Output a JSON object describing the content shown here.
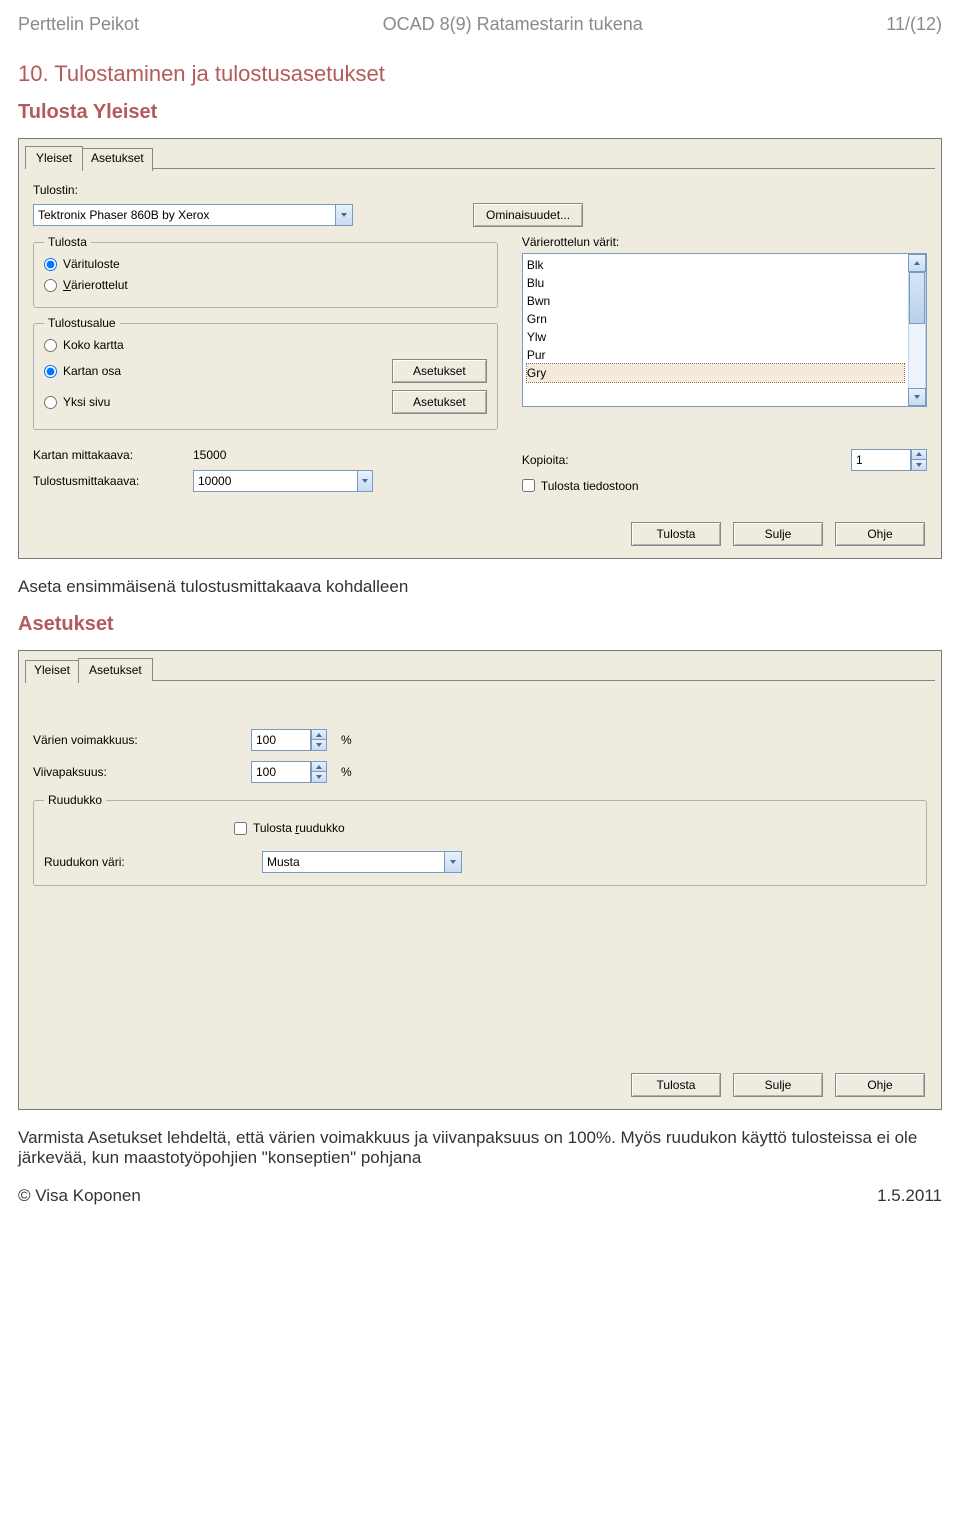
{
  "header": {
    "left": "Perttelin Peikot",
    "center": "OCAD 8(9) Ratamestarin tukena",
    "right": "11/(12)"
  },
  "section_heading": "10. Tulostaminen ja tulostusasetukset",
  "subheading_1": "Tulosta Yleiset",
  "body_text_1": "Aseta ensimmäisenä tulostusmittakaava kohdalleen",
  "subheading_2": "Asetukset",
  "body_text_2": "Varmista Asetukset lehdeltä, että värien voimakkuus ja viivanpaksuus on 100%. Myös ruudukon käyttö tulosteissa ei ole järkevää, kun maastotyöpohjien \"konseptien\" pohjana",
  "footer": {
    "left": "© Visa Koponen",
    "right": "1.5.2011"
  },
  "dialog1": {
    "tabs": {
      "yleiset": "Yleiset",
      "asetukset": "Asetukset"
    },
    "printer_label": "Tulostin:",
    "printer_value": "Tektronix Phaser 860B by Xerox",
    "properties_btn": "Ominaisuudet...",
    "group_tulosta": {
      "legend": "Tulosta",
      "opt_varituloste": "Värituloste",
      "opt_varierottelut": "Värierottelut"
    },
    "group_tulostusalue": {
      "legend": "Tulostusalue",
      "opt_koko": "Koko kartta",
      "opt_kartan": "Kartan osa",
      "opt_yksi": "Yksi sivu",
      "btn_asetukset": "Asetukset"
    },
    "varierottelu_label": "Värierottelun värit:",
    "colors": [
      "Blk",
      "Blu",
      "Bwn",
      "Grn",
      "Ylw",
      "Pur",
      "Gry"
    ],
    "kartan_mk_label": "Kartan mittakaava:",
    "kartan_mk_value": "15000",
    "tulostus_mk_label": "Tulostusmittakaava:",
    "tulostus_mk_value": "10000",
    "kopioita_label": "Kopioita:",
    "kopioita_value": "1",
    "tulosta_tiedostoon": "Tulosta tiedostoon",
    "buttons": {
      "tulosta": "Tulosta",
      "sulje": "Sulje",
      "ohje": "Ohje"
    }
  },
  "dialog2": {
    "tabs": {
      "yleiset": "Yleiset",
      "asetukset": "Asetukset"
    },
    "varien_voimakkuus_label": "Värien voimakkuus:",
    "varien_voimakkuus_value": "100",
    "viivapaksuus_label": "Viivapaksuus:",
    "viivapaksuus_value": "100",
    "percent": "%",
    "group_ruudukko": {
      "legend": "Ruudukko",
      "tulosta_ruudukko": "Tulosta ruudukko",
      "ruudukon_vari_label": "Ruudukon väri:",
      "ruudukon_vari_value": "Musta"
    },
    "buttons": {
      "tulosta": "Tulosta",
      "sulje": "Sulje",
      "ohje": "Ohje"
    }
  }
}
